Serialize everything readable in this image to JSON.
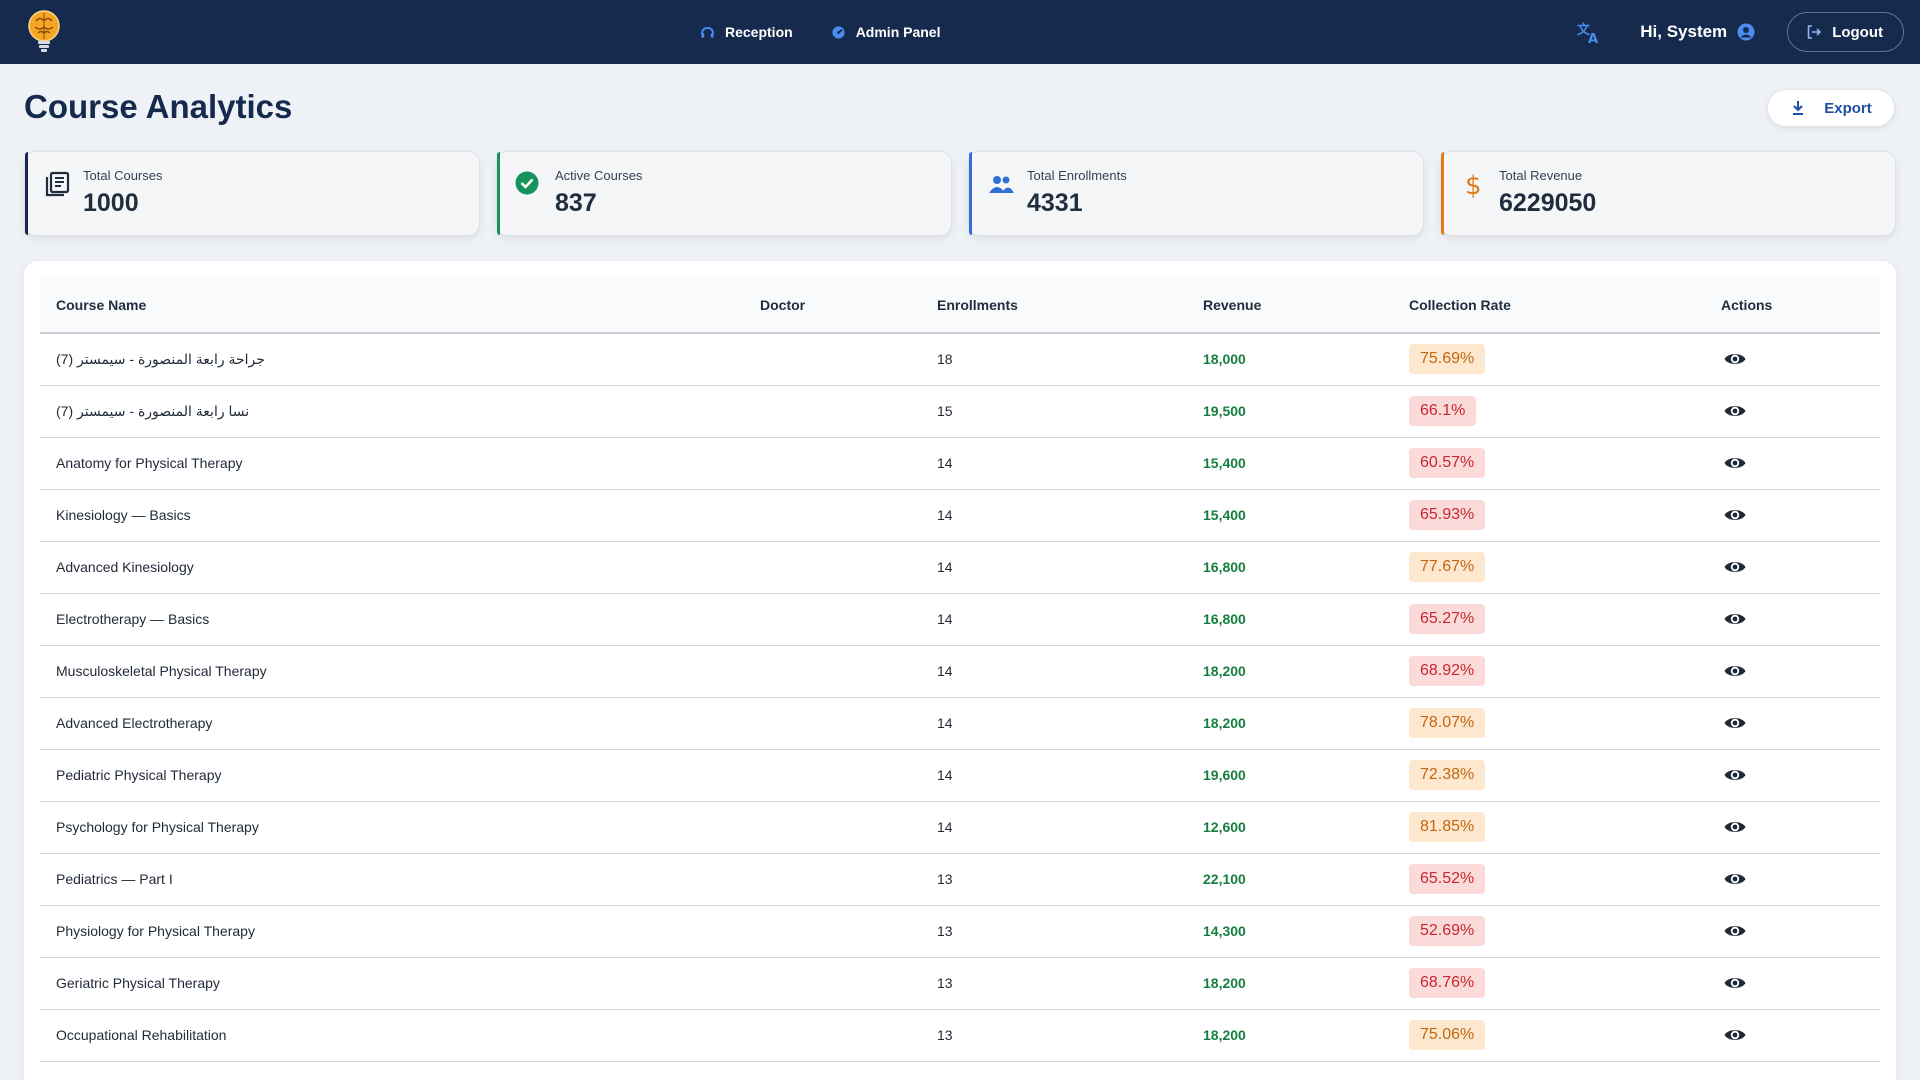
{
  "nav": {
    "reception_label": "Reception",
    "admin_label": "Admin Panel"
  },
  "user": {
    "greeting": "Hi, System",
    "logout_label": "Logout"
  },
  "page": {
    "title": "Course Analytics",
    "export_label": "Export"
  },
  "stats": [
    {
      "label": "Total Courses",
      "value": "1000",
      "icon": "book-stack-icon",
      "color": "#1f2d3d"
    },
    {
      "label": "Active Courses",
      "value": "837",
      "icon": "check-circle-icon",
      "color": "#16935c"
    },
    {
      "label": "Total Enrollments",
      "value": "4331",
      "icon": "people-icon",
      "color": "#2f6fd6"
    },
    {
      "label": "Total Revenue",
      "value": "6229050",
      "icon": "dollar-icon",
      "color": "#e07b17"
    }
  ],
  "table": {
    "headers": {
      "course": "Course Name",
      "doctor": "Doctor",
      "enrollments": "Enrollments",
      "revenue": "Revenue",
      "rate": "Collection Rate",
      "actions": "Actions"
    },
    "rows": [
      {
        "name": "جراحة رابعة المنصورة - سيمستر (7)",
        "doctor": "",
        "enrollments": "18",
        "revenue": "18,000",
        "rate": "75.69%",
        "status": "warn"
      },
      {
        "name": "نسا رابعة المنصورة - سيمستر (7)",
        "doctor": "",
        "enrollments": "15",
        "revenue": "19,500",
        "rate": "66.1%",
        "status": "bad"
      },
      {
        "name": "Anatomy for Physical Therapy",
        "doctor": "",
        "enrollments": "14",
        "revenue": "15,400",
        "rate": "60.57%",
        "status": "bad"
      },
      {
        "name": "Kinesiology — Basics",
        "doctor": "",
        "enrollments": "14",
        "revenue": "15,400",
        "rate": "65.93%",
        "status": "bad"
      },
      {
        "name": "Advanced Kinesiology",
        "doctor": "",
        "enrollments": "14",
        "revenue": "16,800",
        "rate": "77.67%",
        "status": "warn"
      },
      {
        "name": "Electrotherapy — Basics",
        "doctor": "",
        "enrollments": "14",
        "revenue": "16,800",
        "rate": "65.27%",
        "status": "bad"
      },
      {
        "name": "Musculoskeletal Physical Therapy",
        "doctor": "",
        "enrollments": "14",
        "revenue": "18,200",
        "rate": "68.92%",
        "status": "bad"
      },
      {
        "name": "Advanced Electrotherapy",
        "doctor": "",
        "enrollments": "14",
        "revenue": "18,200",
        "rate": "78.07%",
        "status": "warn"
      },
      {
        "name": "Pediatric Physical Therapy",
        "doctor": "",
        "enrollments": "14",
        "revenue": "19,600",
        "rate": "72.38%",
        "status": "warn"
      },
      {
        "name": "Psychology for Physical Therapy",
        "doctor": "",
        "enrollments": "14",
        "revenue": "12,600",
        "rate": "81.85%",
        "status": "warn"
      },
      {
        "name": "Pediatrics — Part I",
        "doctor": "",
        "enrollments": "13",
        "revenue": "22,100",
        "rate": "65.52%",
        "status": "bad"
      },
      {
        "name": "Physiology for Physical Therapy",
        "doctor": "",
        "enrollments": "13",
        "revenue": "14,300",
        "rate": "52.69%",
        "status": "bad"
      },
      {
        "name": "Geriatric Physical Therapy",
        "doctor": "",
        "enrollments": "13",
        "revenue": "18,200",
        "rate": "68.76%",
        "status": "bad"
      },
      {
        "name": "Occupational Rehabilitation",
        "doctor": "",
        "enrollments": "13",
        "revenue": "18,200",
        "rate": "75.06%",
        "status": "warn"
      }
    ]
  },
  "colors": {
    "header_bg": "#152a4c",
    "revenue_text": "#15803d",
    "rate_warn_bg": "#fde7cf",
    "rate_warn_text": "#c2660f",
    "rate_bad_bg": "#fbdada",
    "rate_bad_text": "#c9272d"
  }
}
